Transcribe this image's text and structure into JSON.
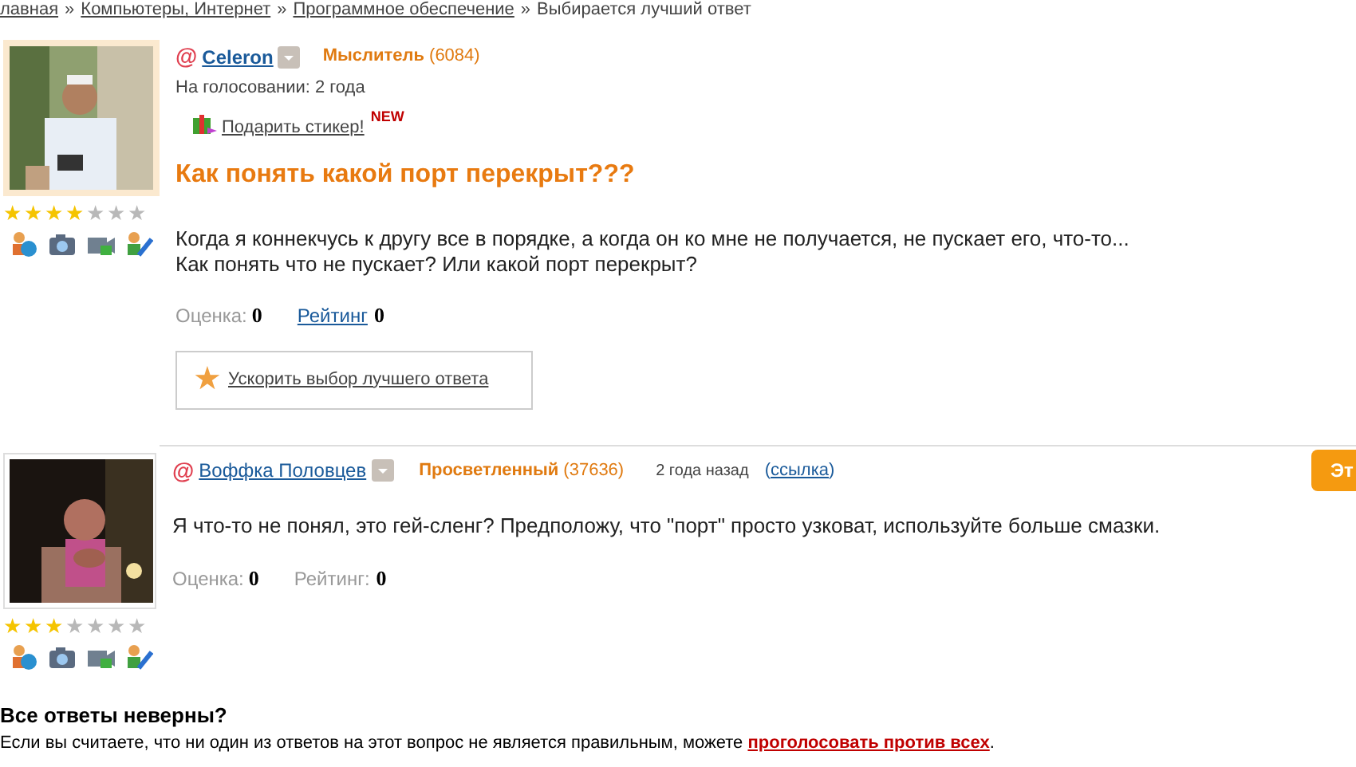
{
  "breadcrumb": {
    "items": [
      "лавная",
      "Компьютеры, Интернет",
      "Программное обеспечение",
      "Выбирается лучший ответ"
    ],
    "separators": [
      "»",
      "»",
      "»"
    ]
  },
  "at_signs": [
    "@",
    "@"
  ],
  "speedup_icon": "★",
  "parens": [
    "(",
    ")"
  ],
  "question": {
    "author": "Celeron",
    "rank": "Мыслитель",
    "points": "(6084)",
    "voting": "На голосовании: 2 года",
    "gift_link": "Подарить стикер!",
    "new_badge": "NEW",
    "stars": 4,
    "title": "Как понять какой порт перекрыт???",
    "body": "Когда я коннекчусь к другу все в порядке, а когда он ко мне не получается, не пускает его, что-то...\nКак понять что не пускает? Или какой порт перекрыт?",
    "score_label": "Оценка:",
    "score": "0",
    "rating_label": "Рейтинг",
    "rating": "0",
    "speedup_link": "Ускорить выбор лучшего ответа"
  },
  "answer": {
    "author": "Воффка Половцев",
    "rank": "Просветленный",
    "points": "(37636)",
    "time": "2 года назад",
    "link": "ссылка",
    "stars": 3,
    "body": "Я что-то не понял, это гей-сленг? Предположу, что \"порт\" просто узковат, используйте больше смазки.",
    "score_label": "Оценка:",
    "score": "0",
    "rating_label": "Рейтинг:",
    "rating": "0",
    "side_button": "Эт"
  },
  "footer": {
    "heading": "Все ответы неверны?",
    "text": "Если вы считаете, что ни один из ответов на этот вопрос не является правильным, можете ",
    "link": "проголосовать против всех",
    "tail": "."
  }
}
